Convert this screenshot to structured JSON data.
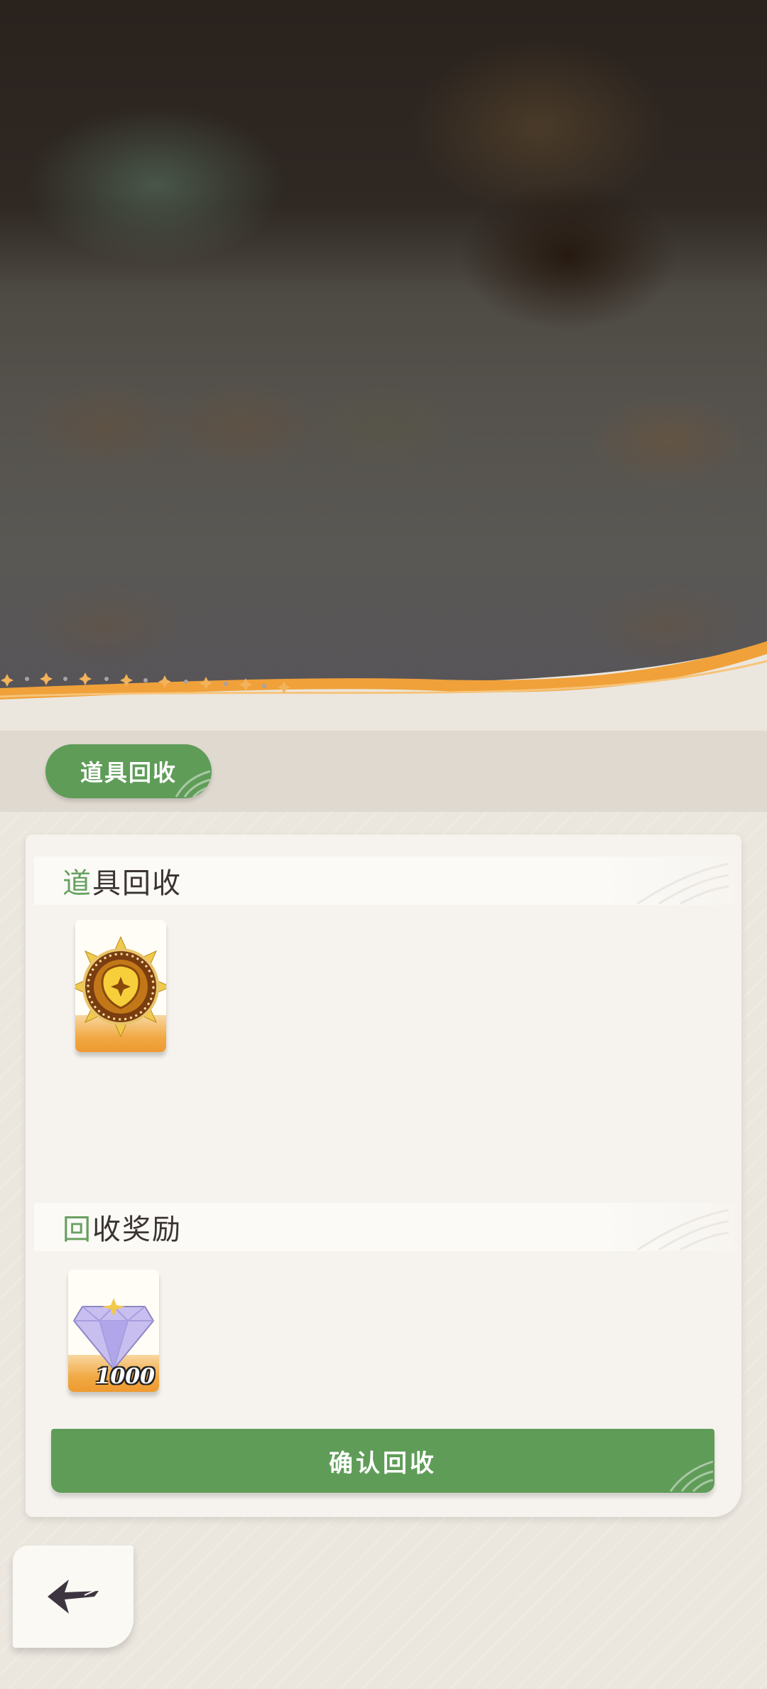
{
  "tab": {
    "label": "道具回收"
  },
  "sections": {
    "recycle": {
      "accent": "道",
      "rest": "具回收"
    },
    "reward": {
      "accent": "回",
      "rest": "收奖励"
    }
  },
  "items": {
    "recycle_item": {
      "icon": "golden-sun-badge-icon"
    },
    "reward_item": {
      "icon": "purple-diamond-icon",
      "quantity": "1000"
    }
  },
  "actions": {
    "confirm_label": "确认回收",
    "back_icon": "back-arrow-icon"
  },
  "colors": {
    "accent_green": "#5f9c58",
    "accent_orange": "#f0a13a",
    "panel": "#f6f3ee"
  }
}
